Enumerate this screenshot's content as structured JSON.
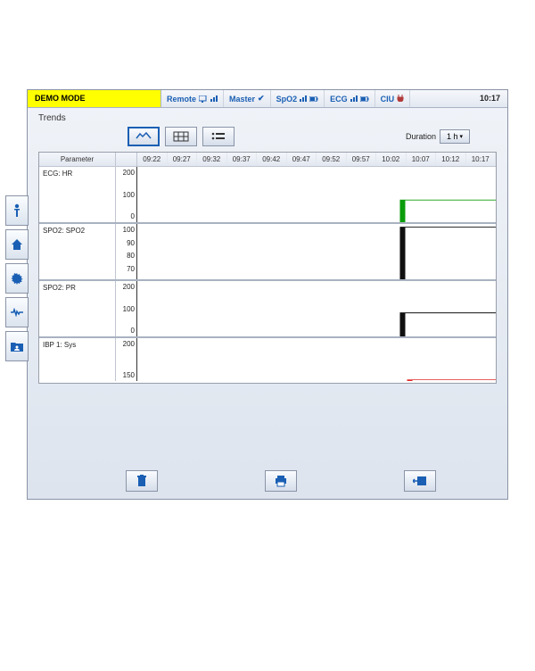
{
  "topbar": {
    "demo_mode": "DEMO MODE",
    "items": [
      {
        "label": "Remote"
      },
      {
        "label": "Master"
      },
      {
        "label": "SpO2"
      },
      {
        "label": "ECG"
      },
      {
        "label": "CIU"
      }
    ],
    "clock": "10:17"
  },
  "title": "Trends",
  "toolbar": {
    "duration_label": "Duration",
    "duration_value": "1 h"
  },
  "chart_header": {
    "parameter": "Parameter",
    "times": [
      "09:22",
      "09:27",
      "09:32",
      "09:37",
      "09:42",
      "09:47",
      "09:52",
      "09:57",
      "10:02",
      "10:07",
      "10:12",
      "10:17"
    ]
  },
  "plots": [
    {
      "name": "ECG: HR",
      "yticks": [
        "200",
        "100",
        "0"
      ],
      "ymin": 0,
      "ymax": 200,
      "color": "#0a9c0a",
      "step_x": 0.74,
      "value": 80
    },
    {
      "name": "SPO2: SPO2",
      "yticks": [
        "100",
        "90",
        "80",
        "70",
        ""
      ],
      "ymin": 65,
      "ymax": 100,
      "color": "#101010",
      "step_x": 0.74,
      "value": 98
    },
    {
      "name": "SPO2: PR",
      "yticks": [
        "200",
        "100",
        "0"
      ],
      "ymin": 0,
      "ymax": 200,
      "color": "#101010",
      "step_x": 0.74,
      "value": 85
    },
    {
      "name": "IBP 1: Sys",
      "yticks": [
        "200",
        "150"
      ],
      "ymin": 130,
      "ymax": 200,
      "color": "#e02a2a",
      "step_x": 0.76,
      "value": 132
    }
  ],
  "chart_data": [
    {
      "type": "line",
      "title": "ECG: HR",
      "ylim": [
        0,
        200
      ],
      "x": [
        "09:22",
        "09:27",
        "09:32",
        "09:37",
        "09:42",
        "09:47",
        "09:52",
        "09:57",
        "10:02",
        "10:07",
        "10:12",
        "10:17"
      ],
      "series": [
        {
          "name": "HR",
          "color": "#0a9c0a",
          "values": [
            null,
            null,
            null,
            null,
            null,
            null,
            null,
            null,
            null,
            80,
            80,
            80
          ]
        }
      ]
    },
    {
      "type": "line",
      "title": "SPO2: SPO2",
      "ylim": [
        65,
        100
      ],
      "x": [
        "09:22",
        "09:27",
        "09:32",
        "09:37",
        "09:42",
        "09:47",
        "09:52",
        "09:57",
        "10:02",
        "10:07",
        "10:12",
        "10:17"
      ],
      "series": [
        {
          "name": "SpO2",
          "color": "#101010",
          "values": [
            null,
            null,
            null,
            null,
            null,
            null,
            null,
            null,
            null,
            98,
            98,
            98
          ]
        }
      ]
    },
    {
      "type": "line",
      "title": "SPO2: PR",
      "ylim": [
        0,
        200
      ],
      "x": [
        "09:22",
        "09:27",
        "09:32",
        "09:37",
        "09:42",
        "09:47",
        "09:52",
        "09:57",
        "10:02",
        "10:07",
        "10:12",
        "10:17"
      ],
      "series": [
        {
          "name": "PR",
          "color": "#101010",
          "values": [
            null,
            null,
            null,
            null,
            null,
            null,
            null,
            null,
            null,
            85,
            85,
            85
          ]
        }
      ]
    },
    {
      "type": "line",
      "title": "IBP 1: Sys",
      "ylim": [
        130,
        200
      ],
      "x": [
        "09:22",
        "09:27",
        "09:32",
        "09:37",
        "09:42",
        "09:47",
        "09:52",
        "09:57",
        "10:02",
        "10:07",
        "10:12",
        "10:17"
      ],
      "series": [
        {
          "name": "Sys",
          "color": "#e02a2a",
          "values": [
            null,
            null,
            null,
            null,
            null,
            null,
            null,
            null,
            null,
            132,
            132,
            132
          ]
        }
      ]
    }
  ]
}
